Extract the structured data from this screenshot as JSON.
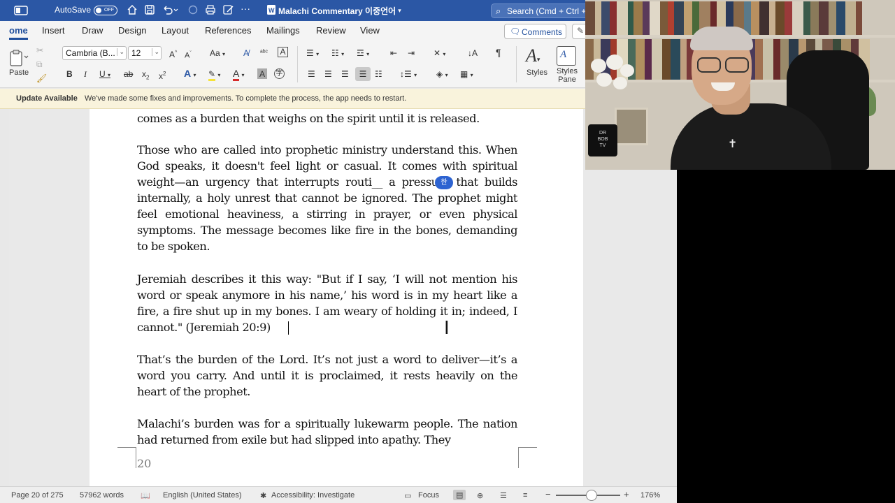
{
  "titlebar": {
    "autosave_label": "AutoSave",
    "autosave_state": "OFF",
    "doc_title": "Malachi Commentary 이중언어",
    "search_placeholder": "Search (Cmd + Ctrl + U)"
  },
  "ribbon_tabs": [
    "Home",
    "Insert",
    "Draw",
    "Design",
    "Layout",
    "References",
    "Mailings",
    "Review",
    "View"
  ],
  "ribbon_tabs_visible": [
    "ome",
    "Insert",
    "Draw",
    "Design",
    "Layout",
    "References",
    "Mailings",
    "Review",
    "View"
  ],
  "active_tab": "Home",
  "comments_button": "Comments",
  "ribbon": {
    "paste_label": "Paste",
    "font_name": "Cambria (B...",
    "font_size": "12",
    "styles_label": "Styles",
    "styles_pane_label": "Styles Pane"
  },
  "notification": {
    "title": "Update Available",
    "message": "We've made some fixes and improvements. To complete the process, the app needs to restart."
  },
  "document": {
    "paragraphs": [
      "comes as a burden that weighs on the spirit until it is released.",
      "Those who are called into prophetic ministry understand this. When God speaks, it doesn't feel light or casual. It comes with spiritual weight—an urgency that interrupts routi__ a pressure that builds internally, a holy unrest that cannot be ignored. The prophet might feel emotional heaviness, a stirring in prayer, or even physical symptoms. The message becomes like fire in the bones, demanding to be spoken.",
      "Jeremiah describes it this way:  \"But if I say, ‘I will not mention his word or speak anymore in his name,’ his word is in my heart like a fire, a fire shut up in my bones. I am weary of holding it in; indeed, I cannot.\" (Jeremiah 20:9)",
      "That’s the burden of the Lord. It’s not just a word to deliver—it’s a word you carry. And until it is proclaimed, it rests heavily on the heart of the prophet.",
      "Malachi’s burden was for a spiritually lukewarm people. The nation had returned from exile but had slipped into apathy. They"
    ],
    "page_number": "20",
    "ime_badge": "한"
  },
  "statusbar": {
    "page": "Page 20 of 275",
    "words": "57962 words",
    "language": "English (United States)",
    "accessibility": "Accessibility: Investigate",
    "focus": "Focus",
    "zoom": "176%",
    "zoom_level_fraction": 0.55
  },
  "colors": {
    "titlebar": "#2b57a5",
    "accent": "#1f4e9c",
    "notification_bg": "#f9f3dc"
  }
}
